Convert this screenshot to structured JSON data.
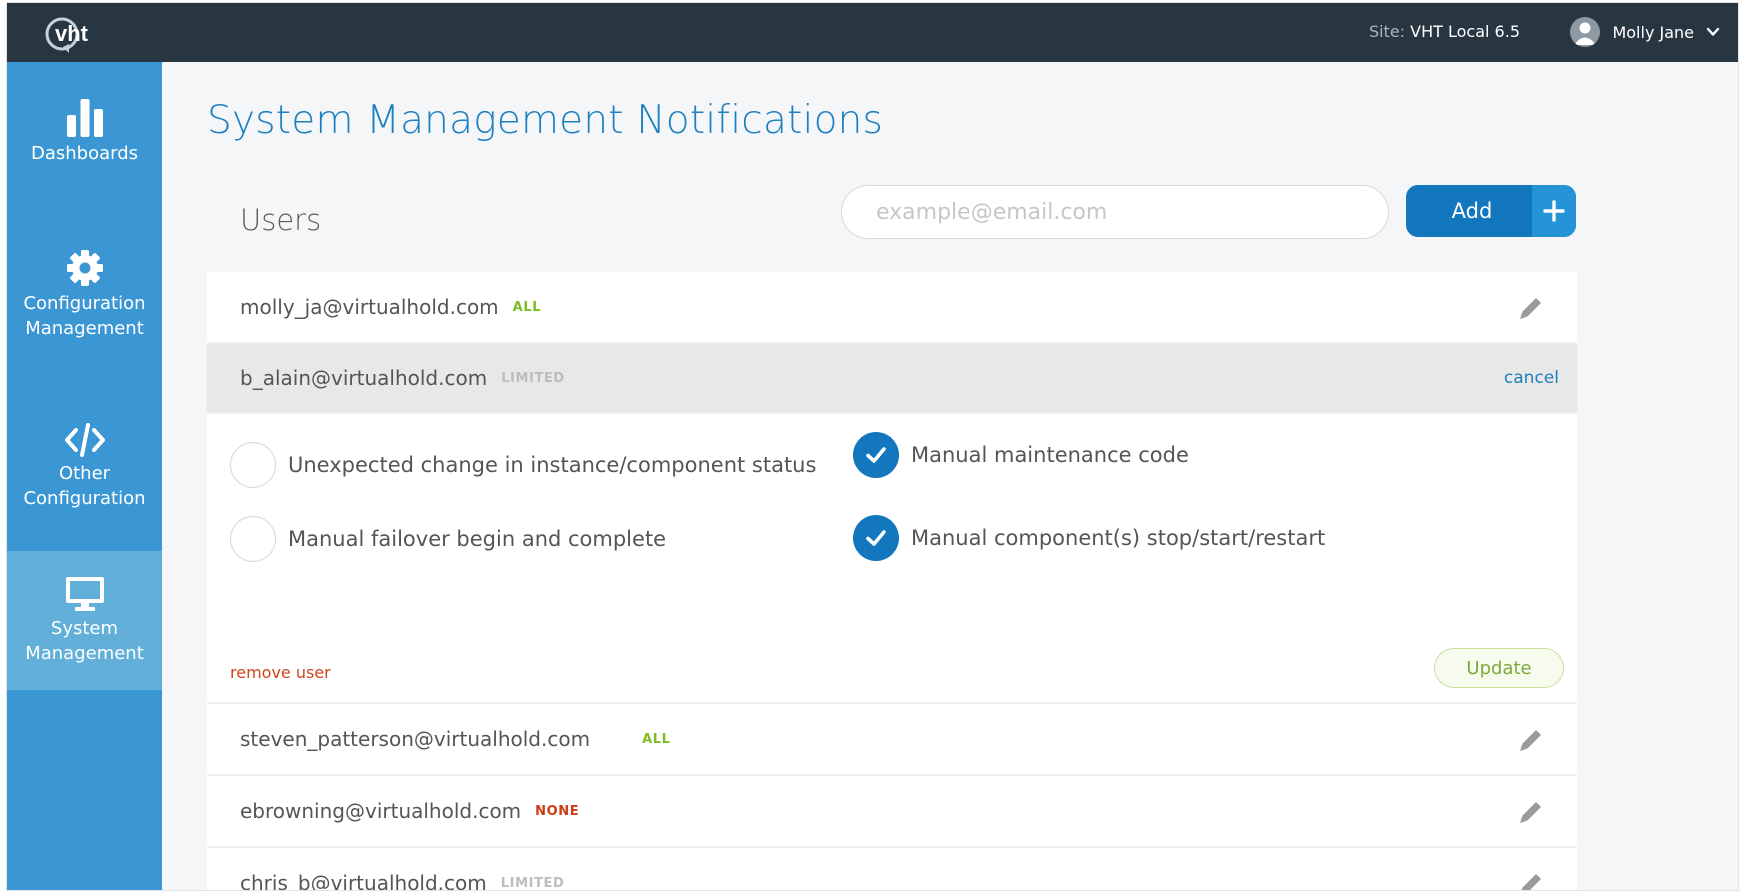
{
  "header": {
    "logo_text": "vht",
    "site_label": "Site:",
    "site_value": "VHT Local 6.5",
    "user_name": "Molly Jane"
  },
  "sidebar": {
    "items": [
      {
        "label": "Dashboards",
        "icon": "bar-chart-icon",
        "active": false
      },
      {
        "label": "Configuration\nManagement",
        "icon": "gear-icon",
        "active": false
      },
      {
        "label": "Other\nConfiguration",
        "icon": "code-icon",
        "active": false
      },
      {
        "label": "System\nManagement",
        "icon": "monitor-icon",
        "active": true
      }
    ]
  },
  "main": {
    "title": "System Management Notifications",
    "users_label": "Users",
    "email_placeholder": "example@email.com",
    "add_label": "Add"
  },
  "users": [
    {
      "email": "molly_ja@virtualhold.com",
      "level": "ALL"
    },
    {
      "email": "b_alain@virtualhold.com",
      "level": "LIMITED",
      "expanded": true
    },
    {
      "email": "steven_patterson@virtualhold.com",
      "level": "ALL"
    },
    {
      "email": "ebrowning@virtualhold.com",
      "level": "NONE"
    },
    {
      "email": "chris_b@virtualhold.com",
      "level": "LIMITED"
    }
  ],
  "edit_panel": {
    "cancel_label": "cancel",
    "options": [
      {
        "label": "Unexpected change in instance/component status",
        "checked": false
      },
      {
        "label": "Manual failover begin and complete",
        "checked": false
      },
      {
        "label": "Manual maintenance code",
        "checked": true
      },
      {
        "label": "Manual component(s) stop/start/restart",
        "checked": true
      }
    ],
    "remove_label": "remove user",
    "update_label": "Update"
  },
  "colors": {
    "topbar": "#283642",
    "sidebar": "#3a97d3",
    "sidebar_active": "#62afd9",
    "accent": "#1277bd",
    "badge_all": "#7bbd22",
    "badge_none": "#d03a12",
    "badge_limited": "#bdbdbd"
  }
}
